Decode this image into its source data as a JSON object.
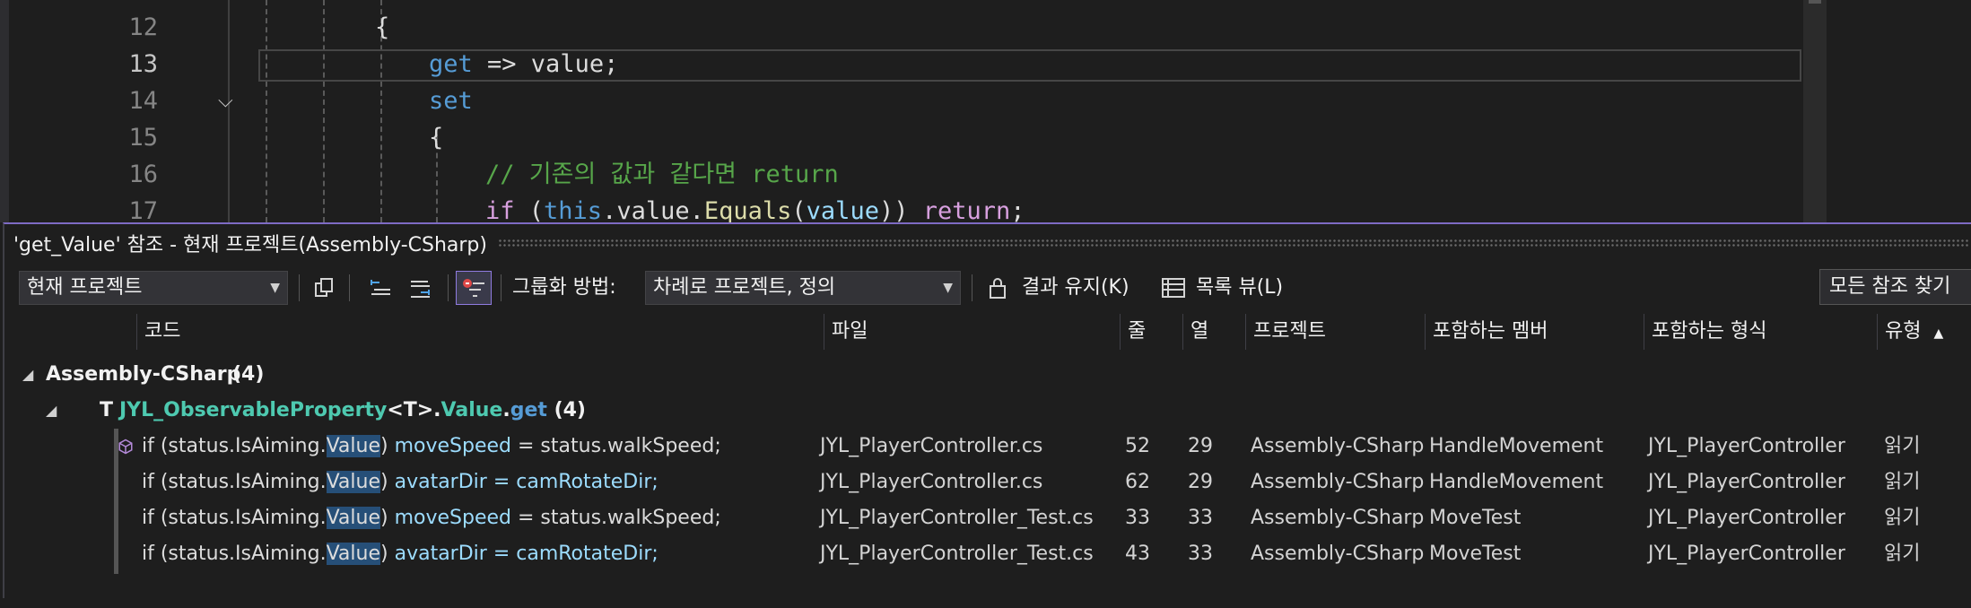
{
  "editor": {
    "lines": [
      {
        "num": "12",
        "indent": 0,
        "tokens": [
          {
            "t": "{",
            "c": "txt"
          }
        ]
      },
      {
        "num": "13",
        "indent": 1,
        "active": true,
        "tokens": [
          {
            "t": "get",
            "c": "kw"
          },
          {
            "t": " => value;",
            "c": "txt"
          }
        ]
      },
      {
        "num": "14",
        "indent": 1,
        "tokens": [
          {
            "t": "set",
            "c": "kw"
          }
        ]
      },
      {
        "num": "15",
        "indent": 1,
        "tokens": [
          {
            "t": "{",
            "c": "txt"
          }
        ]
      },
      {
        "num": "16",
        "indent": 2,
        "tokens": [
          {
            "t": "// 기존의 값과 같다면 return",
            "c": "cm"
          }
        ]
      },
      {
        "num": "17",
        "indent": 2,
        "tokens": [
          {
            "t": "if",
            "c": "ctl"
          },
          {
            "t": " (",
            "c": "txt"
          },
          {
            "t": "this",
            "c": "kw"
          },
          {
            "t": ".value.",
            "c": "txt"
          },
          {
            "t": "Equals",
            "c": "meth"
          },
          {
            "t": "(",
            "c": "txt"
          },
          {
            "t": "value",
            "c": "param"
          },
          {
            "t": ")) ",
            "c": "txt"
          },
          {
            "t": "return",
            "c": "ctl"
          },
          {
            "t": ";",
            "c": "txt"
          }
        ]
      }
    ]
  },
  "panel": {
    "title": "'get_Value' 참조 - 현재 프로젝트(Assembly-CSharp)",
    "scope_value": "현재 프로젝트",
    "group_by_label": "그룹화 방법:",
    "group_by_value": "차례로 프로젝트, 정의",
    "keep_results_label": "결과 유지(K)",
    "list_view_label": "목록 뷰(L)",
    "find_all_label": "모든 참조 찾기"
  },
  "columns": {
    "code": "코드",
    "file": "파일",
    "line": "줄",
    "col": "열",
    "project": "프로젝트",
    "member": "포함하는 멤버",
    "type": "포함하는 형식",
    "kind": "유형"
  },
  "tree": {
    "group_name": "Assembly-CSharp",
    "group_count": "(4)",
    "type_letter": "T",
    "def_class": "JYL_ObservableProperty",
    "def_generic": "<T>.",
    "def_prop": "Value",
    "def_dot": ".",
    "def_get": "get",
    "def_count": "(4)"
  },
  "results": [
    {
      "pre": "if (status.IsAiming.",
      "hl": "Value",
      "mid": ") ",
      "var": "moveSpeed",
      "post": " = status.walkSpeed;",
      "post_class": "txt",
      "file": "JYL_PlayerController.cs",
      "line": "52",
      "col": "29",
      "project": "Assembly-CSharp",
      "member": "HandleMovement",
      "type": "JYL_PlayerController",
      "kind": "읽기"
    },
    {
      "pre": "if (status.IsAiming.",
      "hl": "Value",
      "mid": ") ",
      "var": "avatarDir",
      "post": " = camRotateDir;",
      "post_class": "param",
      "file": "JYL_PlayerController.cs",
      "line": "62",
      "col": "29",
      "project": "Assembly-CSharp",
      "member": "HandleMovement",
      "type": "JYL_PlayerController",
      "kind": "읽기"
    },
    {
      "pre": "if (status.IsAiming.",
      "hl": "Value",
      "mid": ") ",
      "var": "moveSpeed",
      "post": " = status.walkSpeed;",
      "post_class": "txt",
      "file": "JYL_PlayerController_Test.cs",
      "line": "33",
      "col": "33",
      "project": "Assembly-CSharp",
      "member": "MoveTest",
      "type": "JYL_PlayerController",
      "kind": "읽기"
    },
    {
      "pre": "if (status.IsAiming.",
      "hl": "Value",
      "mid": ") ",
      "var": "avatarDir",
      "post": " = camRotateDir;",
      "post_class": "param",
      "file": "JYL_PlayerController_Test.cs",
      "line": "43",
      "col": "33",
      "project": "Assembly-CSharp",
      "member": "MoveTest",
      "type": "JYL_PlayerController",
      "kind": "읽기"
    }
  ],
  "icons": {
    "copy": "copy-icon",
    "prev": "previous-location-icon",
    "next": "next-location-icon",
    "filter": "filter-icon",
    "lock": "lock-icon",
    "list": "list-view-icon",
    "cube": "class-cube-icon"
  },
  "colors": {
    "accent": "#7e6bc4",
    "highlight": "#264f78",
    "type_name": "#4ec9b0",
    "keyword": "#569cd6",
    "comment": "#57a64a"
  }
}
